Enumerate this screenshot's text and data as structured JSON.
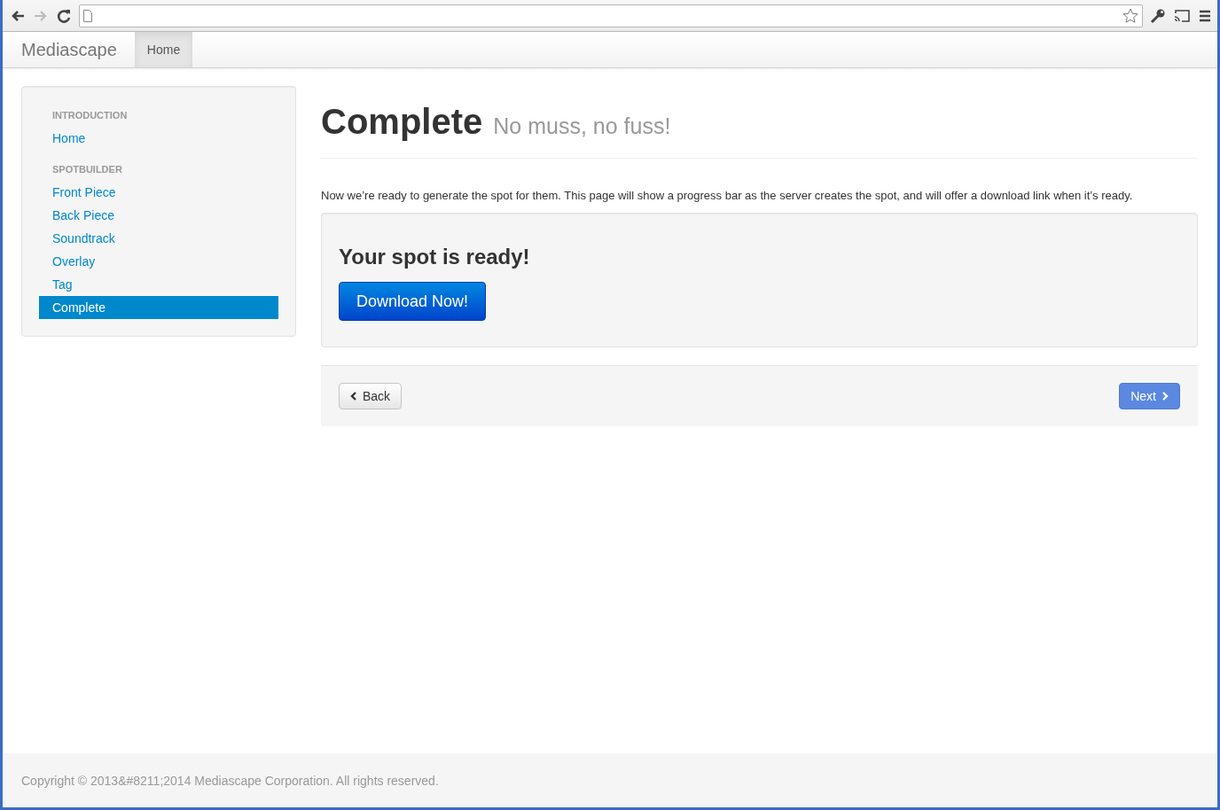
{
  "navbar": {
    "brand": "Mediascape",
    "tabs": [
      {
        "label": "Home",
        "selected": true
      }
    ]
  },
  "sidebar": {
    "sections": [
      {
        "heading": "INTRODUCTION",
        "items": [
          {
            "label": "Home",
            "selected": false
          }
        ]
      },
      {
        "heading": "SPOTBUILDER",
        "items": [
          {
            "label": "Front Piece",
            "selected": false
          },
          {
            "label": "Back Piece",
            "selected": false
          },
          {
            "label": "Soundtrack",
            "selected": false
          },
          {
            "label": "Overlay",
            "selected": false
          },
          {
            "label": "Tag",
            "selected": false
          },
          {
            "label": "Complete",
            "selected": true
          }
        ]
      }
    ]
  },
  "page": {
    "title": "Complete",
    "subtitle": "No muss, no fuss!",
    "intro": "Now we’re ready to generate the spot for them. This page will show a progress bar as the server creates the spot, and will offer a download link when it’s ready.",
    "result": {
      "heading": "Your spot is ready!",
      "button": "Download Now!"
    },
    "pager": [
      {
        "kind": "back",
        "label": "Back"
      },
      {
        "kind": "next",
        "label": "Next"
      }
    ]
  },
  "footer": {
    "text": "Copyright © 2013&#8211;2014 Mediascape Corporation. All rights reserved."
  }
}
